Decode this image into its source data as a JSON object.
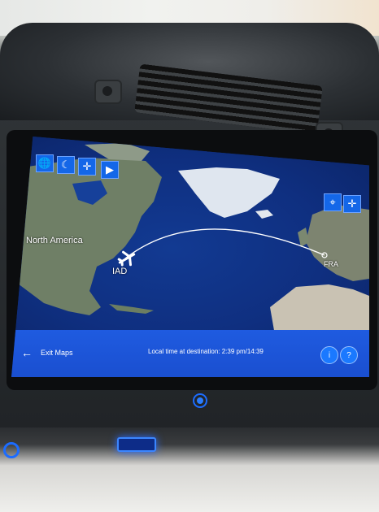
{
  "map": {
    "labels": {
      "continent": "North America",
      "origin": "IAD",
      "destination": "FRA"
    },
    "top_left_icons": [
      "globe-icon",
      "moon-icon",
      "pan-icon",
      "play-icon"
    ],
    "top_right_icons": [
      "locate-icon",
      "pan-icon"
    ]
  },
  "bottom_bar": {
    "exit_label": "Exit Maps",
    "local_time_label": "Local time at destination:",
    "local_time_value": "2:39 pm/14:39",
    "info_label": "i",
    "help_label": "?"
  },
  "colors": {
    "accent": "#1a4fd0",
    "button": "#1467e8",
    "ocean": "#0f2f80"
  }
}
